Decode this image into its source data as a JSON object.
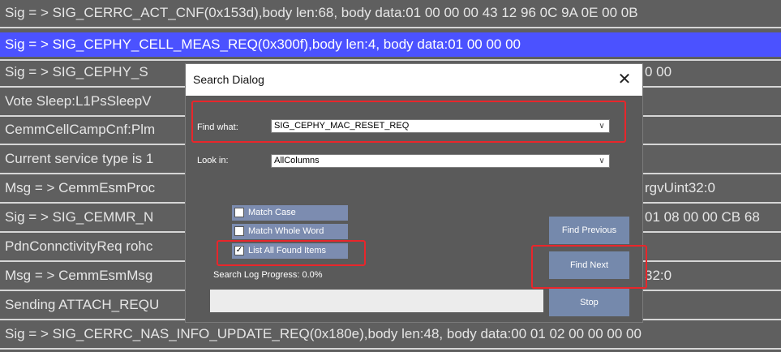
{
  "log_rows": [
    "Sig = > SIG_CERRC_ACT_CNF(0x153d),body len:68, body data:01 00 00 00 43 12 96 0C 9A 0E 00 0B",
    "Sig = > SIG_CEPHY_CELL_MEAS_REQ(0x300f),body len:4, body data:01 00 00 00",
    "Sig = > SIG_CEPHY_S",
    "Vote Sleep:L1PsSleepV",
    "CemmCellCampCnf:Plm",
    "Current service type is 1",
    "Msg = > CemmEsmProc",
    "Sig = > SIG_CEMMR_N",
    "PdnConnctivityReq rohc",
    "Msg = > CemmEsmMsg",
    "Sending ATTACH_REQU",
    "Sig = > SIG_CERRC_NAS_INFO_UPDATE_REQ(0x180e),body len:48, body data:00 01 02 00 00 00 00"
  ],
  "log_right_fragments": {
    "row2": "0 00",
    "row6": "rgvUint32:0",
    "row7": "01 08 00 00 CB 68",
    "row9": "32:0"
  },
  "dialog": {
    "title": "Search Dialog",
    "find_what_label": "Find what:",
    "find_what_value": "SIG_CEPHY_MAC_RESET_REQ",
    "look_in_label": "Look in:",
    "look_in_value": "AllColumns",
    "checkboxes": [
      {
        "label": "Match Case",
        "checked": false
      },
      {
        "label": "Match Whole Word",
        "checked": false
      },
      {
        "label": "List All Found Items",
        "checked": true
      }
    ],
    "progress_label": "Search Log  Progress:  0.0%",
    "progress_value": 0.0,
    "buttons": {
      "find_previous": "Find Previous",
      "find_next": "Find Next",
      "stop": "Stop"
    }
  },
  "icons": {
    "close": "close-icon",
    "dropdown": "chevron-down-icon",
    "check": "check-icon"
  },
  "colors": {
    "selection": "#4b52ff",
    "highlight_box": "#e8262b",
    "button": "#7589ac"
  }
}
